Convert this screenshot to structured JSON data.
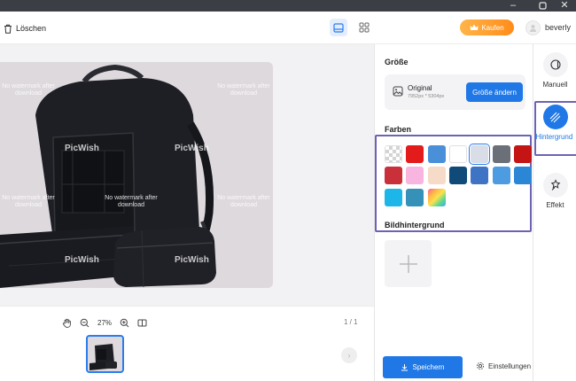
{
  "toolbar": {
    "delete_label": "Löschen",
    "buy_label": "Kaufen",
    "username": "beverly"
  },
  "canvas": {
    "watermark_text_top": "No watermark after download",
    "watermark_text_center": "No watermark after download",
    "watermark_logo": "PicWish"
  },
  "zoom": {
    "level": "27%"
  },
  "pagination": {
    "indicator": "1 / 1"
  },
  "panel": {
    "size_title": "Größe",
    "size_name": "Original",
    "size_dims": "7952px * 5304px",
    "change_size_label": "Größe ändern",
    "colors_title": "Farben",
    "swatches": [
      {
        "color": "checker"
      },
      {
        "color": "#e31b1b"
      },
      {
        "color": "#4a90d9"
      },
      {
        "color": "#ffffff"
      },
      {
        "color": "#d9dde8",
        "selected": true
      },
      {
        "color": "#6b6f78"
      },
      {
        "color": "#c41414"
      },
      {
        "color": "#c9303a"
      },
      {
        "color": "#f7b5e0"
      },
      {
        "color": "#f6dcc8"
      },
      {
        "color": "#0f4a78"
      },
      {
        "color": "#3f74c4"
      },
      {
        "color": "#4d9be0"
      },
      {
        "color": "#2b86d6"
      },
      {
        "color": "#1cb7e8"
      },
      {
        "color": "#3691b8"
      },
      {
        "color": "rainbow"
      }
    ],
    "bg_title": "Bildhintergrund",
    "save_label": "Speichern",
    "settings_label": "Einstellungen"
  },
  "rail": {
    "items": [
      {
        "label": "Manuell"
      },
      {
        "label": "Hintergrund"
      },
      {
        "label": "Effekt"
      }
    ]
  },
  "colors": {
    "accent": "#1f78e6",
    "highlight": "#6c63b5",
    "buy_gradient_start": "#ffb547",
    "buy_gradient_end": "#ff8c1a"
  }
}
